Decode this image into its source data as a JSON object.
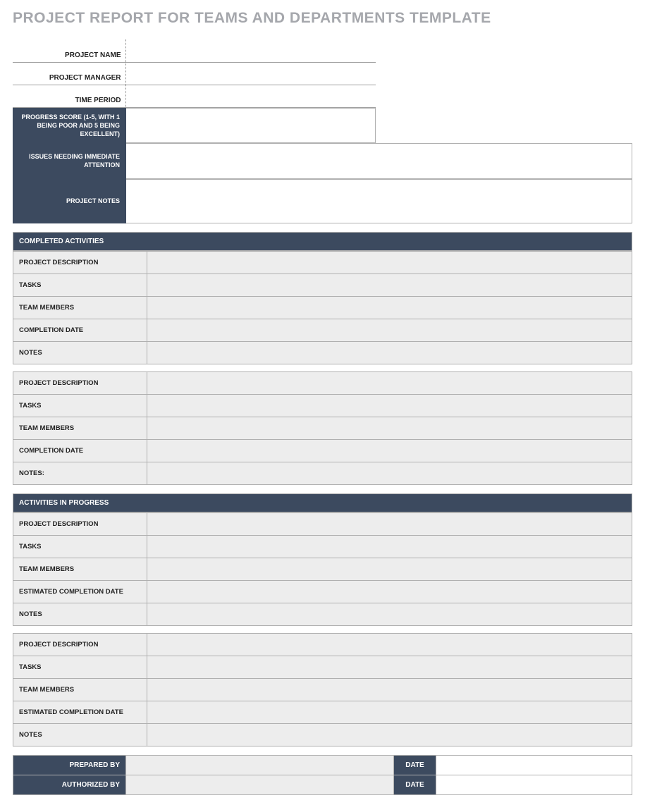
{
  "title": "PROJECT REPORT FOR TEAMS AND DEPARTMENTS TEMPLATE",
  "info": {
    "project_name_label": "PROJECT NAME",
    "project_name": "",
    "project_manager_label": "PROJECT MANAGER",
    "project_manager": "",
    "time_period_label": "TIME PERIOD",
    "time_period": ""
  },
  "status": {
    "progress_label": "PROGRESS SCORE\n(1-5, WITH 1 BEING POOR AND 5 BEING EXCELLENT)",
    "progress_value": "",
    "issues_label": "ISSUES NEEDING IMMEDIATE ATTENTION",
    "issues_value": "",
    "notes_label": "PROJECT NOTES",
    "notes_value": ""
  },
  "sections": {
    "completed_header": "COMPLETED ACTIVITIES",
    "in_progress_header": "ACTIVITIES IN PROGRESS"
  },
  "completed": [
    {
      "project_description_label": "PROJECT DESCRIPTION",
      "project_description": "",
      "tasks_label": "TASKS",
      "tasks": "",
      "team_members_label": "TEAM MEMBERS",
      "team_members": "",
      "completion_date_label": "COMPLETION DATE",
      "completion_date": "",
      "notes_label": "NOTES",
      "notes": ""
    },
    {
      "project_description_label": "PROJECT DESCRIPTION",
      "project_description": "",
      "tasks_label": "TASKS",
      "tasks": "",
      "team_members_label": "TEAM MEMBERS",
      "team_members": "",
      "completion_date_label": "COMPLETION DATE",
      "completion_date": "",
      "notes_label": "NOTES:",
      "notes": ""
    }
  ],
  "in_progress": [
    {
      "project_description_label": "PROJECT DESCRIPTION",
      "project_description": "",
      "tasks_label": "TASKS",
      "tasks": "",
      "team_members_label": "TEAM MEMBERS",
      "team_members": "",
      "est_completion_label": "ESTIMATED COMPLETION DATE",
      "est_completion": "",
      "notes_label": "NOTES",
      "notes": ""
    },
    {
      "project_description_label": "PROJECT DESCRIPTION",
      "project_description": "",
      "tasks_label": "TASKS",
      "tasks": "",
      "team_members_label": "TEAM MEMBERS",
      "team_members": "",
      "est_completion_label": "ESTIMATED COMPLETION DATE",
      "est_completion": "",
      "notes_label": "NOTES",
      "notes": ""
    }
  ],
  "signoff": {
    "prepared_by_label": "PREPARED BY",
    "prepared_by": "",
    "prepared_date_label": "DATE",
    "prepared_date": "",
    "authorized_by_label": "AUTHORIZED BY",
    "authorized_by": "",
    "authorized_date_label": "DATE",
    "authorized_date": ""
  }
}
